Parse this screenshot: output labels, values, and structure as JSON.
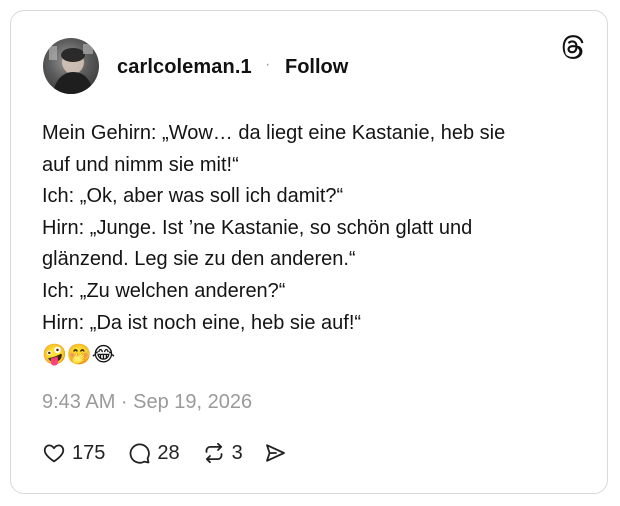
{
  "post": {
    "username": "carlcoleman.1",
    "separator": "·",
    "follow_label": "Follow",
    "lines": [
      "Mein Gehirn: „Wow… da liegt eine Kastanie, heb sie",
      "auf und nimm sie mit!“",
      "Ich: „Ok, aber was soll ich damit?“",
      "Hirn: „Junge. Ist ’ne Kastanie, so schön glatt und",
      "glänzend. Leg sie zu den anderen.“",
      "Ich: „Zu welchen anderen?“",
      "Hirn: „Da ist noch eine, heb sie auf!“"
    ],
    "emojis": "🤪🤭😂",
    "timestamp": "9:43 AM · Sep 19, 2026"
  },
  "actions": {
    "likes": "175",
    "replies": "28",
    "reposts": "3"
  },
  "icons": {
    "logo": "threads-logo-icon",
    "like": "heart-icon",
    "reply": "speech-bubble-icon",
    "repost": "repost-icon",
    "share": "send-icon"
  }
}
